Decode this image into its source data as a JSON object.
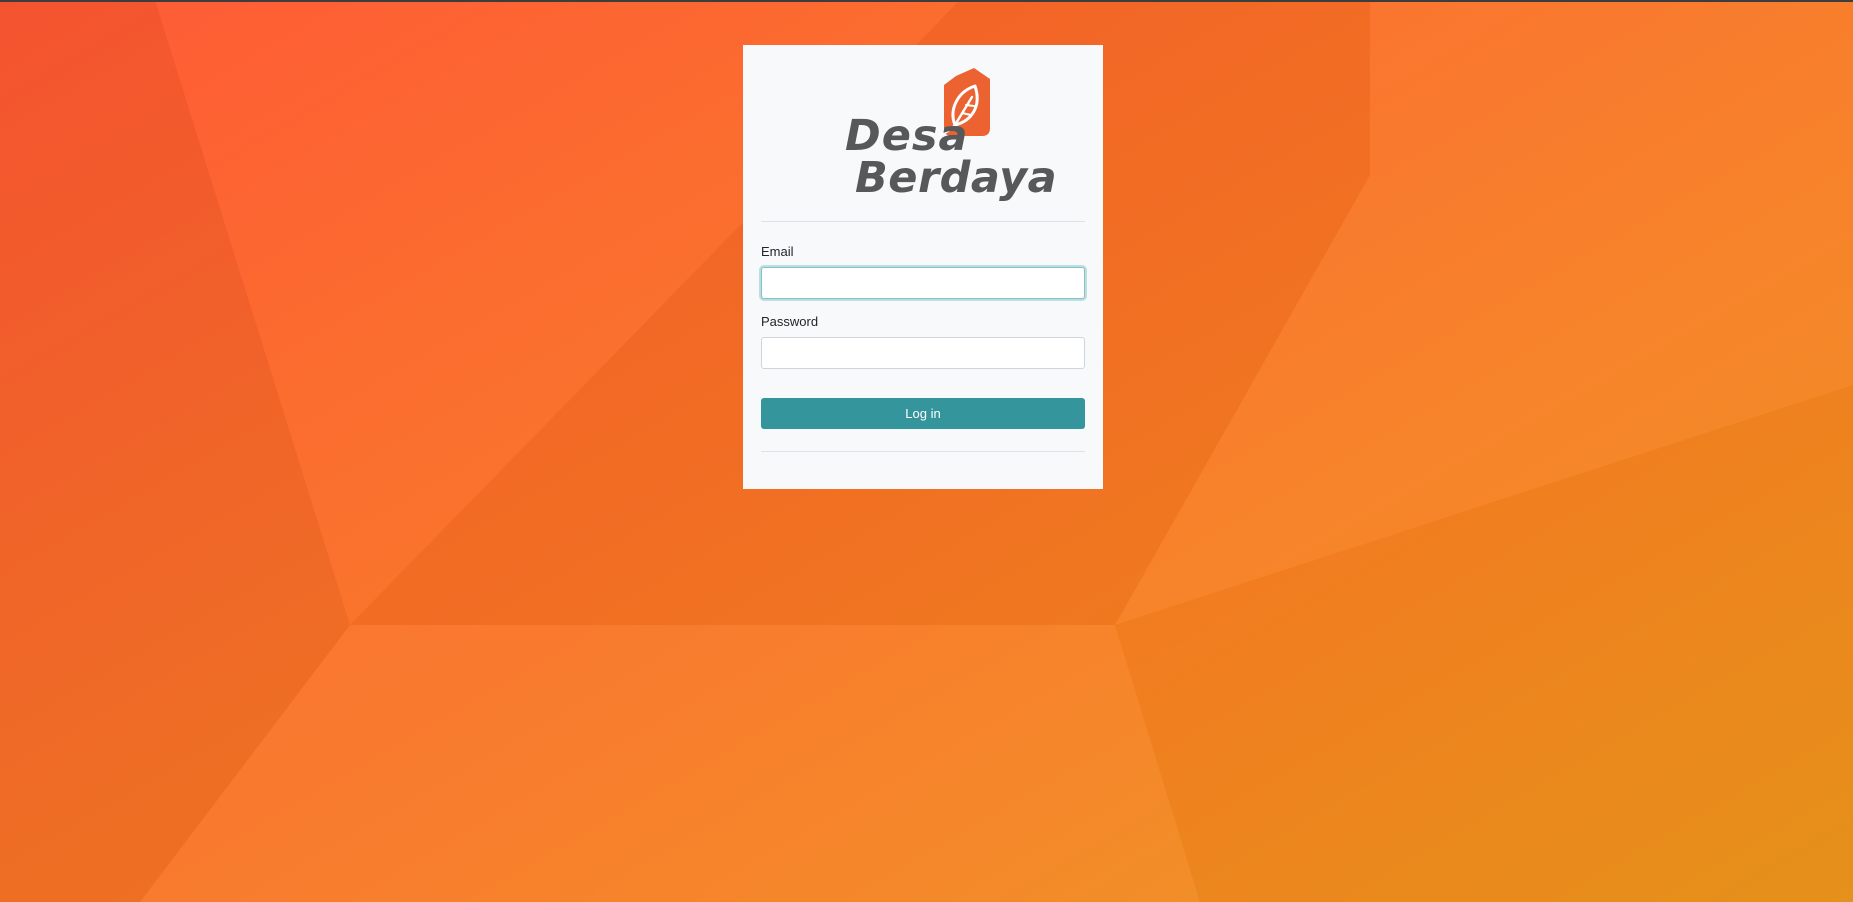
{
  "colors": {
    "accent": "#34969c",
    "brand_orange": "#ec6231",
    "logo_text": "#56585a",
    "card_background": "#f8f9fa",
    "background_start": "#ff5733",
    "background_end": "#ea951c"
  },
  "logo": {
    "line1": "Desa",
    "line2": "Berdaya",
    "icon": "leaf-house-icon"
  },
  "login_form": {
    "email_label": "Email",
    "email_value": "",
    "password_label": "Password",
    "password_value": "",
    "submit_label": "Log in"
  }
}
